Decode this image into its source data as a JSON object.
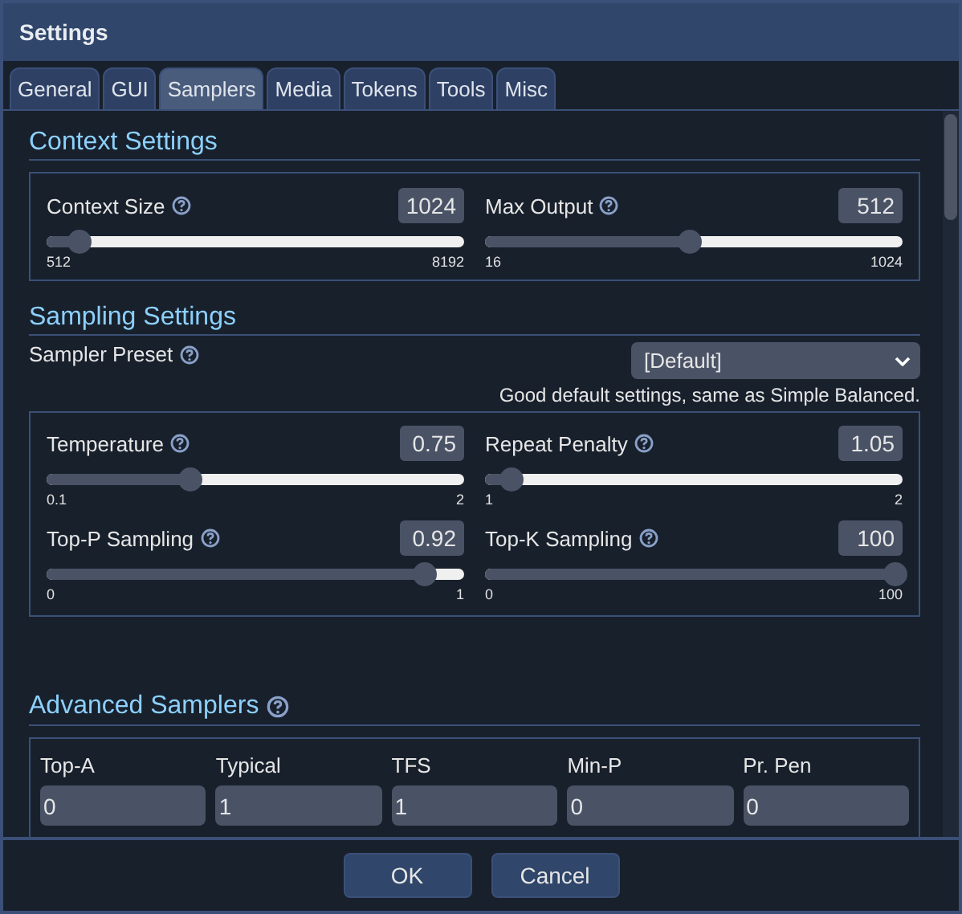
{
  "window": {
    "title": "Settings"
  },
  "tabs": [
    {
      "label": "General",
      "selected": false
    },
    {
      "label": "GUI",
      "selected": false
    },
    {
      "label": "Samplers",
      "selected": true
    },
    {
      "label": "Media",
      "selected": false
    },
    {
      "label": "Tokens",
      "selected": false
    },
    {
      "label": "Tools",
      "selected": false
    },
    {
      "label": "Misc",
      "selected": false
    }
  ],
  "context_settings": {
    "title": "Context Settings",
    "sliders": [
      {
        "label": "Context Size",
        "value": "1024",
        "min": "512",
        "max": "8192",
        "level": 0.067
      },
      {
        "label": "Max Output",
        "value": "512",
        "min": "16",
        "max": "1024",
        "level": 0.492
      }
    ]
  },
  "sampling_settings": {
    "title": "Sampling Settings",
    "preset": {
      "label": "Sampler Preset",
      "value": "[Default]",
      "description": "Good default settings, same as Simple Balanced."
    },
    "sliders": [
      {
        "label": "Temperature",
        "value": "0.75",
        "min": "0.1",
        "max": "2",
        "level": 0.342
      },
      {
        "label": "Repeat Penalty",
        "value": "1.05",
        "min": "1",
        "max": "2",
        "level": 0.05
      },
      {
        "label": "Top-P Sampling",
        "value": "0.92",
        "min": "0",
        "max": "1",
        "level": 0.92
      },
      {
        "label": "Top-K Sampling",
        "value": "100",
        "min": "0",
        "max": "100",
        "level": 1.0
      }
    ]
  },
  "advanced_samplers": {
    "title": "Advanced Samplers",
    "fields": [
      {
        "label": "Top-A",
        "value": "0"
      },
      {
        "label": "Typical",
        "value": "1"
      },
      {
        "label": "TFS",
        "value": "1"
      },
      {
        "label": "Min-P",
        "value": "0"
      },
      {
        "label": "Pr. Pen",
        "value": "0"
      }
    ]
  },
  "buttons": [
    "OK",
    "Cancel"
  ]
}
